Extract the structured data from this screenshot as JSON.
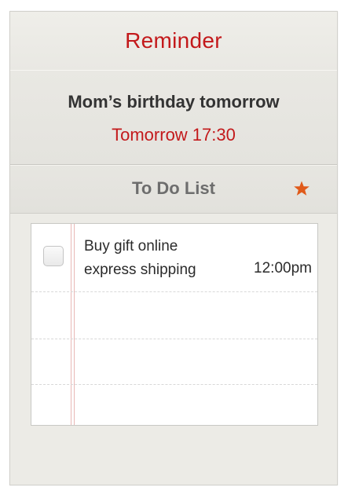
{
  "header": {
    "title": "Reminder"
  },
  "event": {
    "title": "Mom’s birthday tomorrow",
    "time": "Tomorrow 17:30"
  },
  "todo": {
    "title": "To Do List",
    "star_icon": "star-icon",
    "accent_color": "#e05a1a",
    "items": [
      {
        "line1": "Buy gift online",
        "line2": "express shipping",
        "time": "12:00pm",
        "checked": false
      }
    ]
  },
  "colors": {
    "accent_red": "#c3191b",
    "background": "#ecebe6",
    "paper": "#ffffff"
  }
}
